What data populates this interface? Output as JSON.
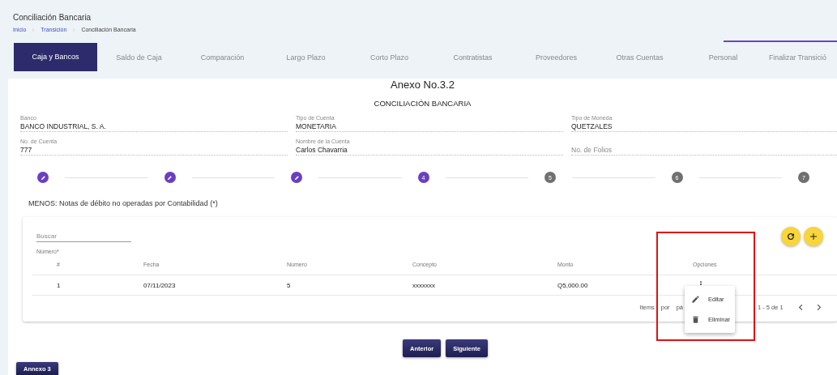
{
  "header": {
    "title": "Conciliación Bancaria",
    "breadcrumb": [
      "Inicio",
      "Transición",
      "Conciliación Bancaria"
    ]
  },
  "tabs": [
    {
      "label": "Caja y Bancos",
      "selected": true
    },
    {
      "label": "Saldo de Caja",
      "selected": false
    },
    {
      "label": "Comparación",
      "selected": false
    },
    {
      "label": "Largo Plazo",
      "selected": false
    },
    {
      "label": "Corto Plazo",
      "selected": false
    },
    {
      "label": "Contratistas",
      "selected": false
    },
    {
      "label": "Proveedores",
      "selected": false
    },
    {
      "label": "Otras Cuentas",
      "selected": false
    },
    {
      "label": "Personal",
      "selected": false
    },
    {
      "label": "Finalizar Transició",
      "selected": false
    }
  ],
  "annex_title": "Anexo No.3.2",
  "subtitle": "CONCILIACIÓN BANCARIA",
  "fields": [
    {
      "label": "Banco",
      "value": "BANCO INDUSTRIAL, S. A."
    },
    {
      "label": "Tipo de Cuenta",
      "value": "MONETARIA"
    },
    {
      "label": "Tipo de Moneda",
      "value": "QUETZALES"
    },
    {
      "label": "No. de Cuenta",
      "value": "777"
    },
    {
      "label": "Nombre de la Cuenta",
      "value": "Carlos Chavarria"
    },
    {
      "placeholder": "No. de Folios"
    }
  ],
  "steps": [
    {
      "kind": "done"
    },
    {
      "kind": "done"
    },
    {
      "kind": "done"
    },
    {
      "kind": "active",
      "label": "4"
    },
    {
      "kind": "pending",
      "label": "5"
    },
    {
      "kind": "pending",
      "label": "6"
    },
    {
      "kind": "pending",
      "label": "7"
    }
  ],
  "section_heading": "MENOS: Notas de débito no operadas por Contabilidad (*)",
  "table": {
    "search": {
      "placeholder": "Buscar",
      "hint": "Número*"
    },
    "columns": [
      "#",
      "Fecha",
      "Número",
      "Concepto",
      "Monto",
      "Opciones"
    ],
    "rows": [
      {
        "cells": [
          "1",
          "07/11/2023",
          "5",
          "xxxxxxx",
          "Q5,000.00"
        ]
      }
    ],
    "paginator": {
      "label": "Items por pá",
      "range": "1 - 5 de 1"
    }
  },
  "row_menu": {
    "items": [
      {
        "kind": "edit",
        "label": "Editar"
      },
      {
        "kind": "delete",
        "label": "Eliminar"
      }
    ]
  },
  "nav_buttons": [
    "Anterior",
    "Siguiente"
  ],
  "annex_button": "Annexo 3"
}
